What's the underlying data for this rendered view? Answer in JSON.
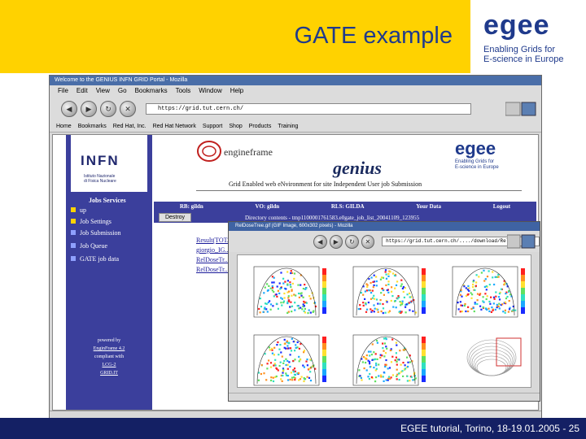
{
  "slide": {
    "title": "GATE example",
    "logo_word": "egee",
    "logo_tag_1": "Enabling Grids for",
    "logo_tag_2": "E-science in Europe",
    "footer": "EGEE tutorial, Torino, 18-19.01.2005 - 25"
  },
  "browser": {
    "title": "Welcome to the GENIUS INFN GRID Portal - Mozilla",
    "menu": [
      "File",
      "Edit",
      "View",
      "Go",
      "Bookmarks",
      "Tools",
      "Window",
      "Help"
    ],
    "url": "https://grid.tut.cern.ch/",
    "bookmarks": [
      "Home",
      "Bookmarks",
      "Red Hat, Inc.",
      "Red Hat Network",
      "Support",
      "Shop",
      "Products",
      "Training"
    ]
  },
  "page": {
    "infn": "INFN",
    "infn_sub_1": "Istituto Nazionale",
    "infn_sub_2": "di Fisica Nucleare",
    "menu_head": "Jobs Services",
    "menu_items": [
      "up",
      "Job Settings",
      "Job Submission",
      "Job Queue",
      "GATE job data"
    ],
    "powered": [
      "powered by",
      "EnginFrame 4.2",
      "compliant with",
      "LCG-2",
      "GRID.IT"
    ],
    "enginframe": "engineframe",
    "genius": "genius",
    "egee_word": "egee",
    "egee_tag_1": "Enabling Grids for",
    "egee_tag_2": "E-science in Europe",
    "acronym": "Grid Enabled web eNvironment for site Independent User job Submission",
    "info": [
      "RB: gildn",
      "VO: gildn",
      "RLS: GILDA",
      "Your Data",
      "Logout"
    ],
    "destroy": "Destroy",
    "directory": "Directory contents - tmp1100001761583.e0gate_job_list_20041109_123955",
    "files": [
      "Result(TOT...",
      "giorgio_IG...",
      "RelDoseTr...",
      "RelDoseTr..."
    ]
  },
  "popup": {
    "title": "RelDoseTree.gif (GIF Image, 600x302 pixels) - Mozilla",
    "url": "https://grid.tut.cern.ch/..../download/RelDose"
  }
}
